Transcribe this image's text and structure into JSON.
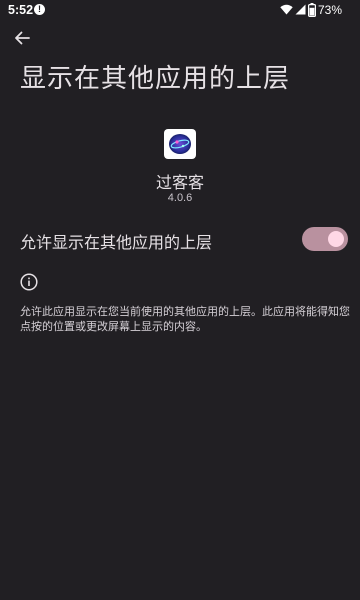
{
  "status_bar": {
    "time": "5:52",
    "alert_glyph": "!",
    "battery_percent": "73%",
    "icons": [
      "alert-icon",
      "wifi-icon",
      "signal-icon",
      "battery-icon"
    ]
  },
  "header": {
    "title": "显示在其他应用的上层",
    "back_icon": "arrow-back-icon"
  },
  "app": {
    "name": "过客客",
    "version": "4.0.6"
  },
  "setting": {
    "label": "允许显示在其他应用的上层",
    "enabled": true
  },
  "info": {
    "icon": "info-icon",
    "description": "允许此应用显示在您当前使用的其他应用的上层。此应用将能得知您点按的位置或更改屏幕上显示的内容。"
  },
  "colors": {
    "background": "#211f23",
    "text": "#e6e1e5",
    "toggle_track": "#b9919f",
    "toggle_thumb": "#ffd8e6"
  }
}
